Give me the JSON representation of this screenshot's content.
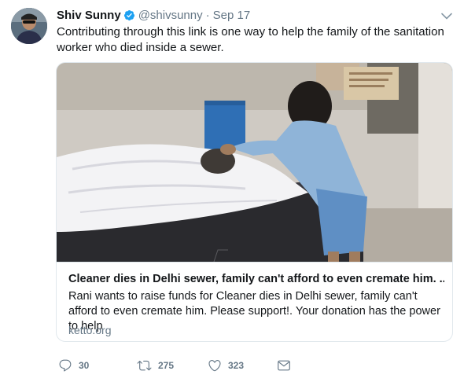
{
  "tweet": {
    "display_name": "Shiv Sunny",
    "handle": "@shivsunny",
    "separator": "·",
    "time": "Sep 17",
    "text": "Contributing through this link is one way to help the family of the sanitation worker who died inside a sewer."
  },
  "card": {
    "title": "Cleaner dies in Delhi sewer, family can't afford to even cremate him. ...",
    "description": "Rani wants to raise funds for Cleaner dies in Delhi sewer, family can't afford to even cremate him. Please support!. Your donation has the power to help",
    "domain": "ketto.org"
  },
  "actions": {
    "reply_count": "30",
    "retweet_count": "275",
    "like_count": "323"
  },
  "colors": {
    "verified": "#1da1f2",
    "secondary_text": "#657786",
    "border": "#e1e8ed"
  },
  "icons": [
    "verified-badge-icon",
    "chevron-down-icon",
    "reply-icon",
    "retweet-icon",
    "like-icon",
    "direct-message-icon"
  ]
}
